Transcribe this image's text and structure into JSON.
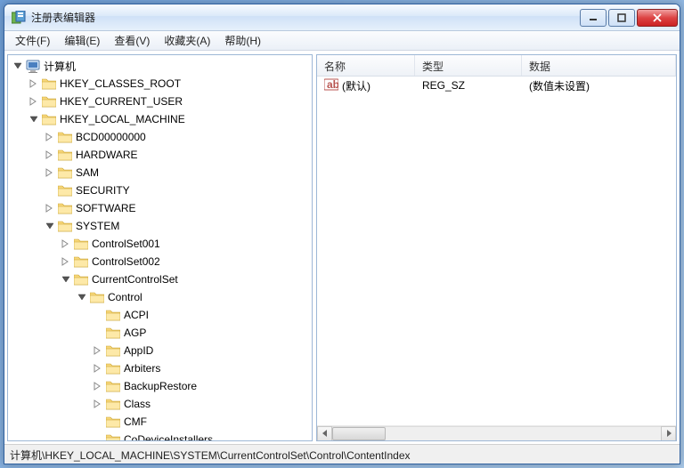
{
  "window": {
    "title": "注册表编辑器"
  },
  "menu": {
    "file": "文件(F)",
    "edit": "编辑(E)",
    "view": "查看(V)",
    "favorites": "收藏夹(A)",
    "help": "帮助(H)"
  },
  "tree": {
    "root": "计算机",
    "hkcr": "HKEY_CLASSES_ROOT",
    "hkcu": "HKEY_CURRENT_USER",
    "hklm": "HKEY_LOCAL_MACHINE",
    "bcd": "BCD00000000",
    "hardware": "HARDWARE",
    "sam": "SAM",
    "security": "SECURITY",
    "software": "SOFTWARE",
    "system": "SYSTEM",
    "cs001": "ControlSet001",
    "cs002": "ControlSet002",
    "ccs": "CurrentControlSet",
    "control": "Control",
    "acpi": "ACPI",
    "agp": "AGP",
    "appid": "AppID",
    "arbiters": "Arbiters",
    "backuprestore": "BackupRestore",
    "class": "Class",
    "cmf": "CMF",
    "codevice": "CoDeviceInstallers"
  },
  "list": {
    "headers": {
      "name": "名称",
      "type": "类型",
      "data": "数据"
    },
    "col_widths": {
      "name": 110,
      "type": 120,
      "data": 160
    },
    "rows": [
      {
        "name": "(默认)",
        "type": "REG_SZ",
        "data": "(数值未设置)"
      }
    ]
  },
  "statusbar": {
    "path": "计算机\\HKEY_LOCAL_MACHINE\\SYSTEM\\CurrentControlSet\\Control\\ContentIndex"
  }
}
